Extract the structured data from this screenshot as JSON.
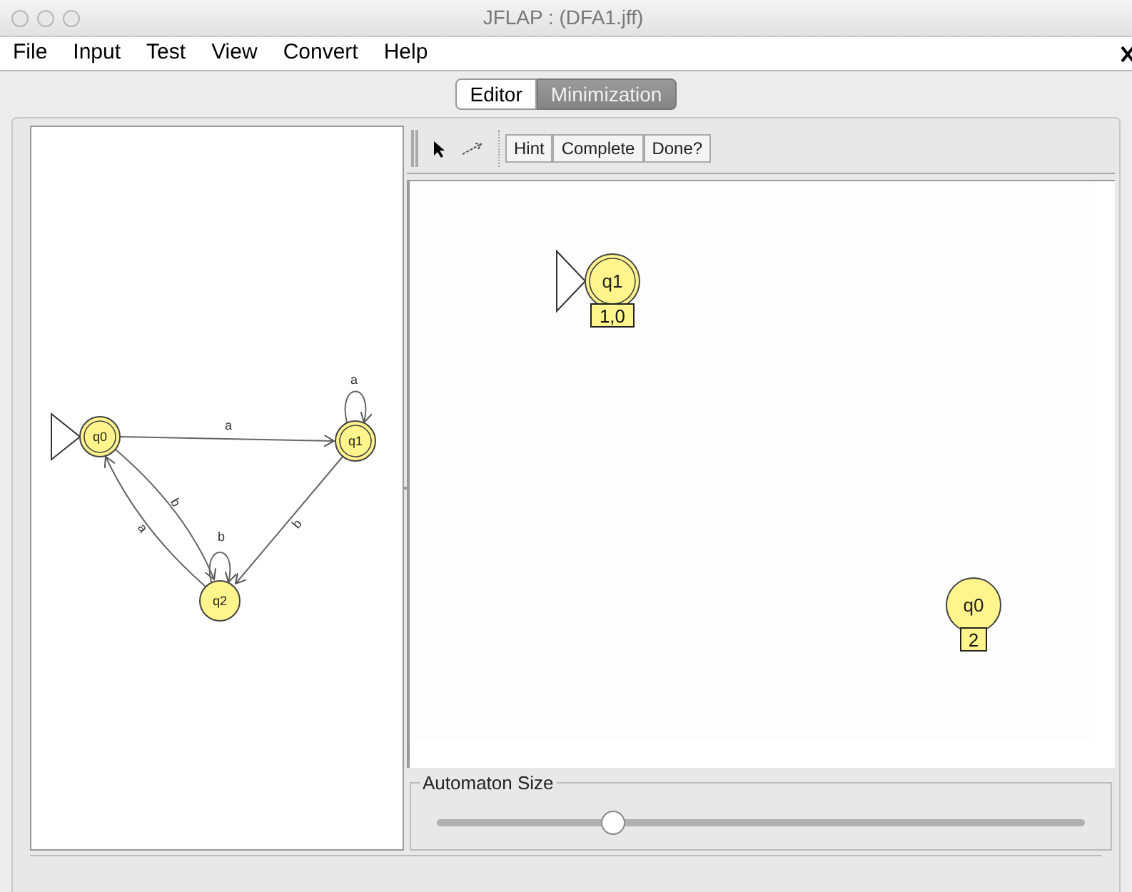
{
  "window": {
    "title": "JFLAP : (DFA1.jff)"
  },
  "menu": [
    "File",
    "Input",
    "Test",
    "View",
    "Convert",
    "Help"
  ],
  "tabs": [
    {
      "label": "Editor",
      "selected": false
    },
    {
      "label": "Minimization",
      "selected": true
    }
  ],
  "toolbar": {
    "buttons": [
      "Hint",
      "Complete",
      "Done?"
    ]
  },
  "original_automaton": {
    "states": [
      {
        "label": "q0",
        "initial": true,
        "final": true
      },
      {
        "label": "q1",
        "initial": false,
        "final": true
      },
      {
        "label": "q2",
        "initial": false,
        "final": false
      }
    ],
    "transitions": [
      {
        "label": "a"
      },
      {
        "label": "a"
      },
      {
        "label": "b"
      },
      {
        "label": "b"
      },
      {
        "label": "a"
      },
      {
        "label": "b"
      }
    ]
  },
  "minimized_automaton": {
    "states": [
      {
        "label": "q1",
        "set": "1,0",
        "initial": true,
        "final": true
      },
      {
        "label": "q0",
        "set": "2",
        "initial": false,
        "final": false
      }
    ]
  },
  "automaton_size": {
    "title": "Automaton Size",
    "level": 0.27
  }
}
